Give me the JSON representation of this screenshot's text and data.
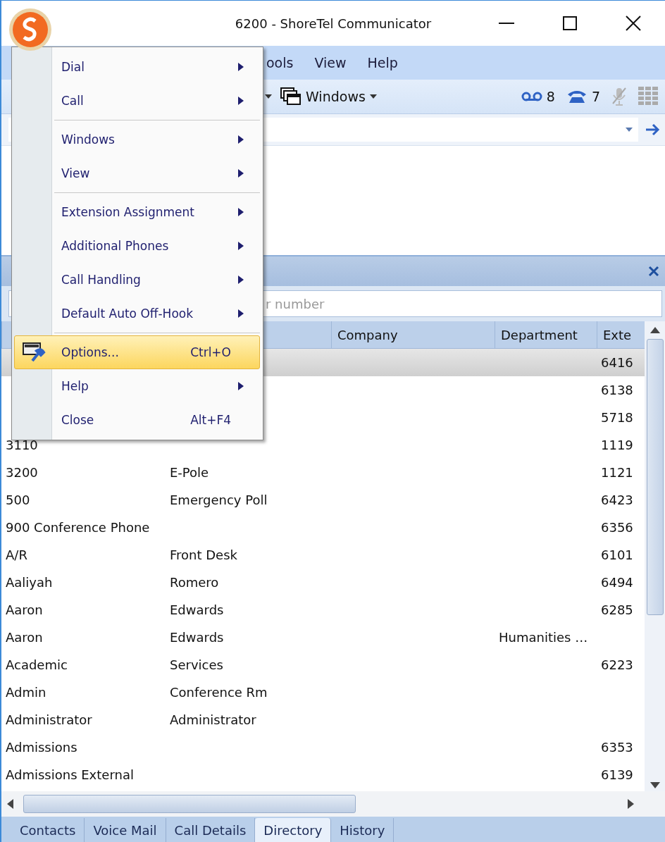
{
  "window": {
    "title": "6200 - ShoreTel Communicator"
  },
  "menubar": [
    "ools",
    "View",
    "Help"
  ],
  "toolbar": {
    "windows_label": "Windows",
    "voicemail_count": "8",
    "calls_count": "7"
  },
  "panel": {
    "search_placeholder": "r number"
  },
  "table": {
    "columns": [
      "Company",
      "Department",
      "Exte"
    ],
    "rows": [
      {
        "first": "",
        "last": "",
        "company": "",
        "department": "",
        "ext": "6416",
        "selected": true
      },
      {
        "first": "",
        "last": "",
        "company": "",
        "department": "",
        "ext": "6138",
        "selected": false
      },
      {
        "first": "",
        "last": "",
        "company": "",
        "department": "",
        "ext": "5718",
        "selected": false
      },
      {
        "first": "3110",
        "last": "",
        "company": "",
        "department": "",
        "ext": "1119",
        "selected": false
      },
      {
        "first": "3200",
        "last": "E-Pole",
        "company": "",
        "department": "",
        "ext": "1121",
        "selected": false
      },
      {
        "first": "500",
        "last": "Emergency Poll",
        "company": "",
        "department": "",
        "ext": "6423",
        "selected": false
      },
      {
        "first": "900 Conference Phone",
        "last": "",
        "company": "",
        "department": "",
        "ext": "6356",
        "selected": false
      },
      {
        "first": "A/R",
        "last": "Front Desk",
        "company": "",
        "department": "",
        "ext": "6101",
        "selected": false
      },
      {
        "first": "Aaliyah",
        "last": "Romero",
        "company": "",
        "department": "",
        "ext": "6494",
        "selected": false
      },
      {
        "first": "Aaron",
        "last": "Edwards",
        "company": "",
        "department": "",
        "ext": "6285",
        "selected": false
      },
      {
        "first": "Aaron",
        "last": "Edwards",
        "company": "",
        "department": "Humanities …",
        "ext": "",
        "selected": false
      },
      {
        "first": "Academic",
        "last": "Services",
        "company": "",
        "department": "",
        "ext": "6223",
        "selected": false
      },
      {
        "first": "Admin",
        "last": "Conference Rm",
        "company": "",
        "department": "",
        "ext": "",
        "selected": false
      },
      {
        "first": "Administrator",
        "last": "Administrator",
        "company": "",
        "department": "",
        "ext": "",
        "selected": false
      },
      {
        "first": "Admissions",
        "last": "",
        "company": "",
        "department": "",
        "ext": "6353",
        "selected": false
      },
      {
        "first": "Admissions External",
        "last": "",
        "company": "",
        "department": "",
        "ext": "6139",
        "selected": false
      }
    ]
  },
  "tabs": [
    {
      "label": "Contacts",
      "selected": false
    },
    {
      "label": "Voice Mail",
      "selected": false
    },
    {
      "label": "Call Details",
      "selected": false
    },
    {
      "label": "Directory",
      "selected": true
    },
    {
      "label": "History",
      "selected": false
    }
  ],
  "menu": {
    "groups": [
      [
        {
          "label": "Dial",
          "submenu": true,
          "selected": false
        },
        {
          "label": "Call",
          "submenu": true,
          "selected": false
        }
      ],
      [
        {
          "label": "Windows",
          "submenu": true,
          "selected": false
        },
        {
          "label": "View",
          "submenu": true,
          "selected": false
        }
      ],
      [
        {
          "label": "Extension Assignment",
          "submenu": true,
          "selected": false
        },
        {
          "label": "Additional Phones",
          "submenu": true,
          "selected": false
        },
        {
          "label": "Call Handling",
          "submenu": true,
          "selected": false
        },
        {
          "label": "Default Auto Off-Hook",
          "submenu": true,
          "selected": false
        }
      ],
      [
        {
          "label": "Options...",
          "shortcut": "Ctrl+O",
          "icon": true,
          "selected": true
        },
        {
          "label": "Help",
          "submenu": true,
          "selected": false
        },
        {
          "label": "Close",
          "shortcut": "Alt+F4",
          "selected": false
        }
      ]
    ]
  }
}
